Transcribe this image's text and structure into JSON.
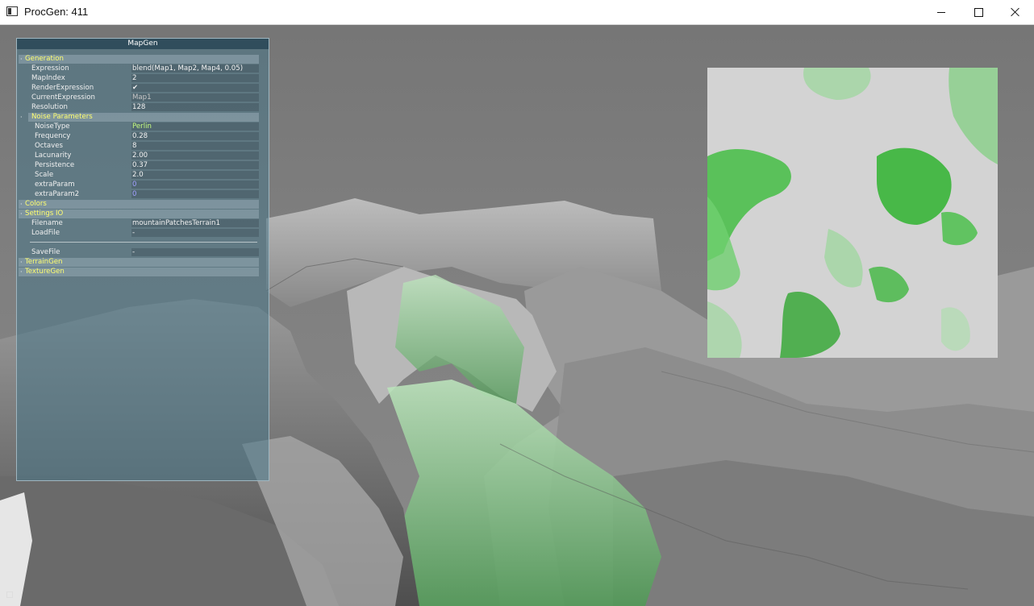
{
  "window": {
    "title": "ProcGen: 411"
  },
  "panel": {
    "title": "MapGen",
    "generation": {
      "label": "Generation",
      "expression_label": "Expression",
      "expression_value": "blend(Map1, Map2, Map4, 0.05)",
      "mapindex_label": "MapIndex",
      "mapindex_value": "2",
      "renderexpression_label": "RenderExpression",
      "renderexpression_value": "✔",
      "currentexpression_label": "CurrentExpression",
      "currentexpression_value": "Map1",
      "resolution_label": "Resolution",
      "resolution_value": "128"
    },
    "noise": {
      "label": "Noise Parameters",
      "noisetype_label": "NoiseType",
      "noisetype_value": "Perlin",
      "frequency_label": "Frequency",
      "frequency_value": "0.28",
      "octaves_label": "Octaves",
      "octaves_value": "8",
      "lacunarity_label": "Lacunarity",
      "lacunarity_value": "2.00",
      "persistence_label": "Persistence",
      "persistence_value": "0.37",
      "scale_label": "Scale",
      "scale_value": "2.0",
      "extraparam_label": "extraParam",
      "extraparam_value": "0",
      "extraparam2_label": "extraParam2",
      "extraparam2_value": "0"
    },
    "colors": {
      "label": "Colors"
    },
    "settings_io": {
      "label": "Settings IO",
      "filename_label": "Filename",
      "filename_value": "mountainPatchesTerrain1",
      "loadfile_label": "LoadFile",
      "loadfile_value": "-",
      "savefile_label": "SaveFile",
      "savefile_value": "-"
    },
    "terraingen": {
      "label": "TerrainGen"
    },
    "texturegen": {
      "label": "TextureGen"
    }
  },
  "colors": {
    "group_label": "#ffff70",
    "accent_green": "#3cb43c",
    "panel_bg": "#487688"
  }
}
